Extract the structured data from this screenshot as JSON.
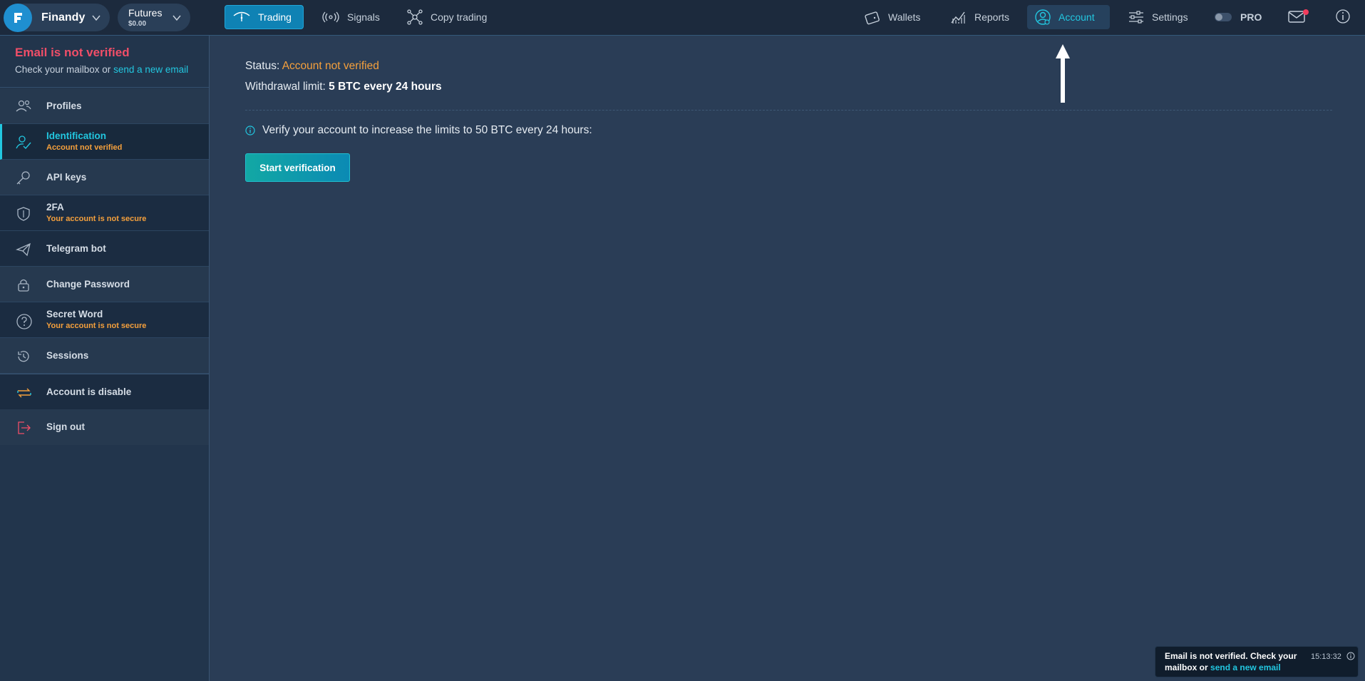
{
  "header": {
    "brand_name": "Finandy",
    "market": {
      "title": "Futures",
      "balance": "$0.00"
    },
    "nav": {
      "trading": "Trading",
      "signals": "Signals",
      "copy_trading": "Copy trading",
      "wallets": "Wallets",
      "reports": "Reports",
      "account": "Account",
      "settings": "Settings",
      "pro": "PRO"
    }
  },
  "sidebar": {
    "alert": {
      "title": "Email is not verified",
      "text": "Check your mailbox or ",
      "link": "send a new email"
    },
    "items": [
      {
        "label": "Profiles",
        "icon": "profiles-icon"
      },
      {
        "label": "Identification",
        "sub": "Account not verified",
        "icon": "identification-icon",
        "active": true
      },
      {
        "label": "API keys",
        "icon": "key-icon"
      },
      {
        "label": "2FA",
        "sub": "Your account is not secure",
        "icon": "shield-icon"
      },
      {
        "label": "Telegram bot",
        "icon": "telegram-icon"
      },
      {
        "label": "Change Password",
        "icon": "lock-icon"
      },
      {
        "label": "Secret Word",
        "sub": "Your account is not secure",
        "icon": "question-icon"
      },
      {
        "label": "Sessions",
        "icon": "sessions-icon"
      },
      {
        "label": "Account is disable",
        "icon": "swap-icon"
      },
      {
        "label": "Sign out",
        "icon": "sign-out-icon"
      }
    ]
  },
  "main": {
    "status_label": "Status: ",
    "status_value": "Account not verified",
    "withdrawal_label": "Withdrawal limit: ",
    "withdrawal_value": "5 BTC every 24 hours",
    "verify_text": "Verify your account to increase the limits to 50 BTC every 24 hours:",
    "start_button": "Start verification"
  },
  "toast": {
    "text": "Email is not verified. Check your mailbox or ",
    "link": "send a new email",
    "time": "15:13:32"
  },
  "colors": {
    "accent": "#22c7e0",
    "warning": "#f5a03c",
    "error": "#f04e68",
    "background": "#2a3d56"
  }
}
